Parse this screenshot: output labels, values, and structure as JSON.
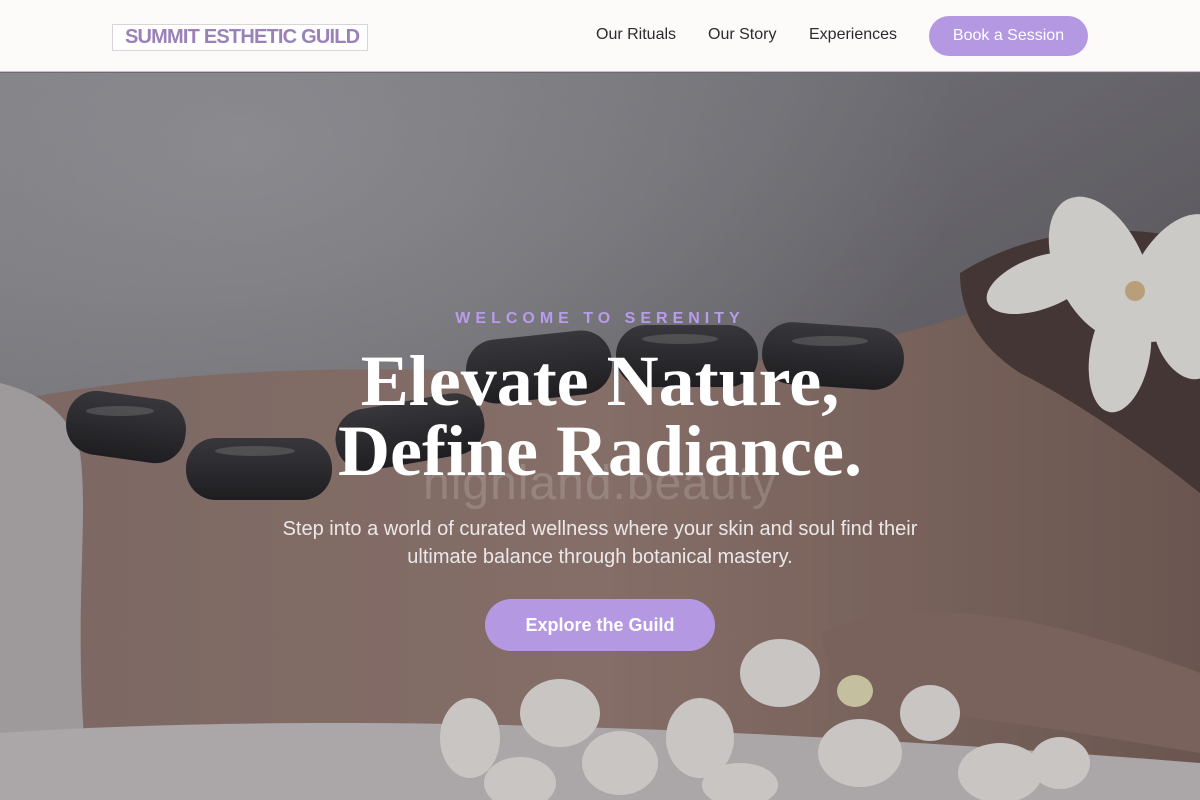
{
  "header": {
    "logo": "SUMMIT ESTHETIC GUILD",
    "nav": [
      "Our Rituals",
      "Our Story",
      "Experiences"
    ],
    "book_label": "Book a Session"
  },
  "hero": {
    "eyebrow": "WELCOME TO SERENITY",
    "headline_line1": "Elevate Nature,",
    "headline_line2": "Define Radiance.",
    "watermark": "highland.beauty",
    "subtext": "Step into a world of curated wellness where your skin and soul find their ultimate balance through botanical mastery.",
    "cta_label": "Explore the Guild"
  },
  "colors": {
    "accent": "#b598e2",
    "logo": "#9a82b8",
    "eyebrow": "#b79cea"
  }
}
